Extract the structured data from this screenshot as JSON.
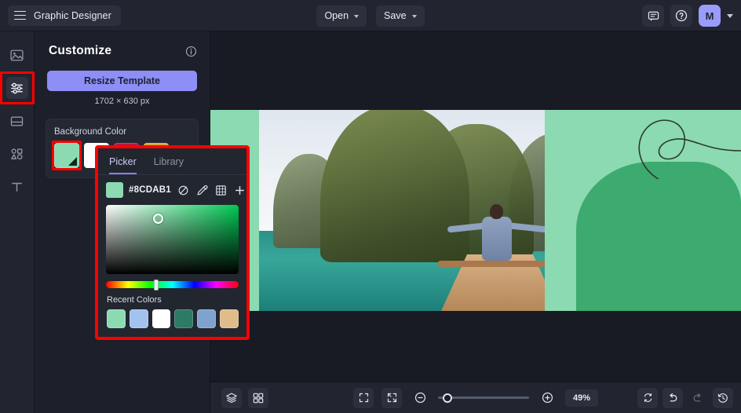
{
  "app": {
    "title": "Graphic Designer",
    "accent": "#8d8ef6",
    "background": "#181a24"
  },
  "topbar": {
    "menu_icon": "hamburger-icon",
    "open_label": "Open",
    "save_label": "Save",
    "comment_icon": "comment-icon",
    "help_icon": "help-circle-icon",
    "avatar_initial": "M",
    "account_caret_icon": "chevron-down-icon"
  },
  "rail": {
    "items": [
      {
        "name": "images",
        "icon": "image-icon",
        "active": false
      },
      {
        "name": "customize",
        "icon": "sliders-icon",
        "active": true
      },
      {
        "name": "layout",
        "icon": "layout-icon",
        "active": false
      },
      {
        "name": "elements",
        "icon": "shapes-icon",
        "active": false
      },
      {
        "name": "text",
        "icon": "text-icon",
        "active": false
      }
    ]
  },
  "panel": {
    "title": "Customize",
    "info_icon": "info-circle-icon",
    "resize_label": "Resize Template",
    "dimensions": "1702 × 630 px",
    "background_color_label": "Background Color",
    "swatches": [
      {
        "color": "#8cdab1",
        "selected": true
      },
      {
        "color": "#ffffff",
        "selected": false
      },
      {
        "color": "#c2163c",
        "selected": false
      },
      {
        "color": "#e7a33a",
        "selected": false
      }
    ]
  },
  "picker": {
    "tab_picker": "Picker",
    "tab_library": "Library",
    "hex_value": "#8CDAB1",
    "swatch_color": "#8cdab1",
    "tools": [
      {
        "name": "no-color-icon"
      },
      {
        "name": "eyedropper-icon"
      },
      {
        "name": "palette-grid-icon"
      },
      {
        "name": "add-color-icon"
      }
    ],
    "hue_position_pct": 36,
    "sv_base_color": "#00c853",
    "recent_label": "Recent Colors",
    "recent_colors": [
      "#8cdab1",
      "#a2c2f0",
      "#ffffff",
      "#2d7a66",
      "#7fa3cc",
      "#dfbc8a"
    ]
  },
  "bottombar": {
    "layers_icon": "layers-icon",
    "pages_icon": "grid-pages-icon",
    "fullscreen_icon": "fullscreen-icon",
    "fit_icon": "fit-to-screen-icon",
    "zoom_out_icon": "minus-circle-icon",
    "zoom_in_icon": "plus-circle-icon",
    "zoom_value": "49%",
    "zoom_slider_pct": 10,
    "sync_icon": "sync-icon",
    "undo_icon": "undo-icon",
    "redo_icon": "redo-icon",
    "history_icon": "history-icon"
  },
  "canvas": {
    "artboard_bg": "#ffffff",
    "graphic_green_light": "#8cdab1",
    "graphic_green_dark": "#3daa6f",
    "photo_description": "tropical lagoon with limestone karsts and woman on boat"
  }
}
